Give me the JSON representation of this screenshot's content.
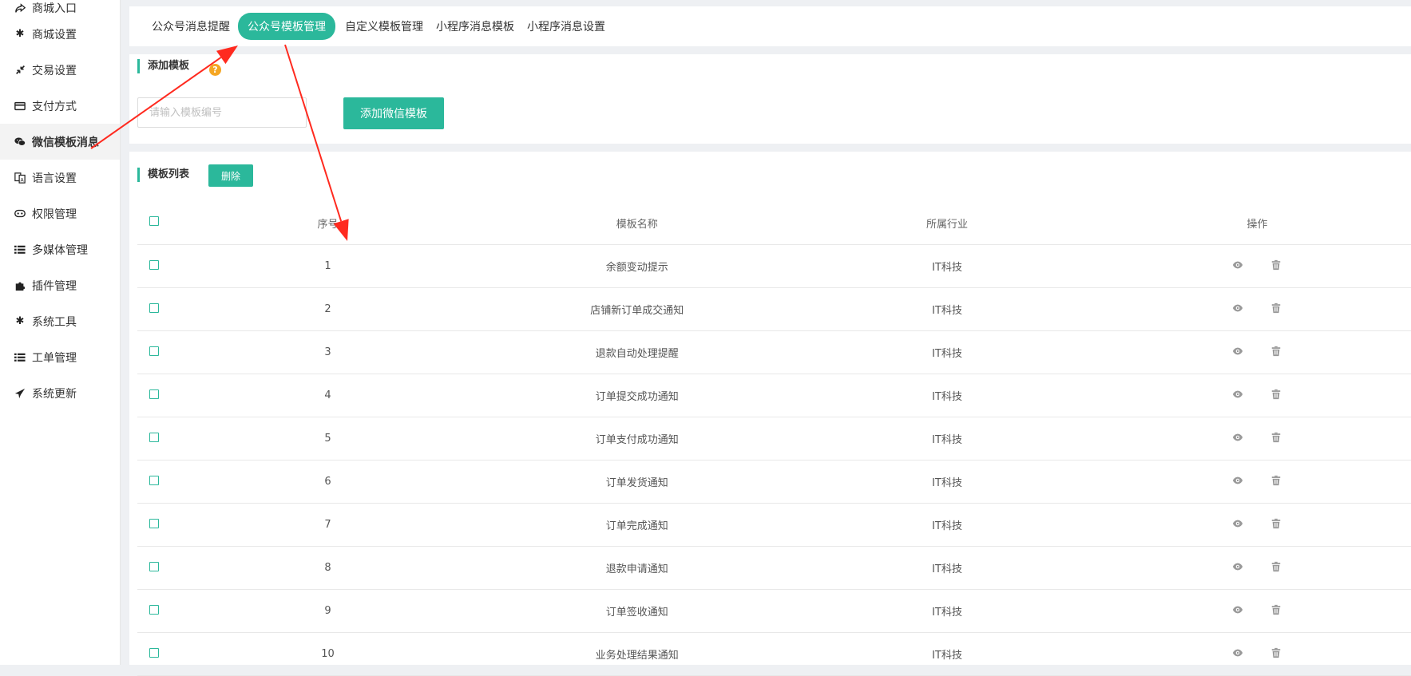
{
  "sidebar": {
    "items": [
      {
        "label": "商城入口",
        "icon": "share-icon"
      },
      {
        "label": "商城设置",
        "icon": "gear-icon"
      },
      {
        "label": "交易设置",
        "icon": "compress-icon"
      },
      {
        "label": "支付方式",
        "icon": "credit-card-icon"
      },
      {
        "label": "微信模板消息",
        "icon": "wechat-icon"
      },
      {
        "label": "语言设置",
        "icon": "translate-icon"
      },
      {
        "label": "权限管理",
        "icon": "gamepad-icon"
      },
      {
        "label": "多媒体管理",
        "icon": "list-icon"
      },
      {
        "label": "插件管理",
        "icon": "puzzle-icon"
      },
      {
        "label": "系统工具",
        "icon": "gear-icon"
      },
      {
        "label": "工单管理",
        "icon": "list-icon"
      },
      {
        "label": "系统更新",
        "icon": "paper-plane-icon"
      }
    ],
    "active_index": 4
  },
  "tabs": [
    {
      "label": "公众号消息提醒"
    },
    {
      "label": "公众号模板管理"
    },
    {
      "label": "自定义模板管理"
    },
    {
      "label": "小程序消息模板"
    },
    {
      "label": "小程序消息设置"
    }
  ],
  "add_section": {
    "title": "添加模板",
    "help": "?",
    "input_placeholder": "请输入模板编号",
    "input_value": "",
    "add_button": "添加微信模板"
  },
  "list_section": {
    "title": "模板列表",
    "delete_button": "删除",
    "columns": [
      "序号",
      "模板名称",
      "所属行业",
      "操作"
    ],
    "rows": [
      {
        "index": "1",
        "name": "余额变动提示",
        "industry": "IT科技"
      },
      {
        "index": "2",
        "name": "店铺新订单成交通知",
        "industry": "IT科技"
      },
      {
        "index": "3",
        "name": "退款自动处理提醒",
        "industry": "IT科技"
      },
      {
        "index": "4",
        "name": "订单提交成功通知",
        "industry": "IT科技"
      },
      {
        "index": "5",
        "name": "订单支付成功通知",
        "industry": "IT科技"
      },
      {
        "index": "6",
        "name": "订单发货通知",
        "industry": "IT科技"
      },
      {
        "index": "7",
        "name": "订单完成通知",
        "industry": "IT科技"
      },
      {
        "index": "8",
        "name": "退款申请通知",
        "industry": "IT科技"
      },
      {
        "index": "9",
        "name": "订单签收通知",
        "industry": "IT科技"
      },
      {
        "index": "10",
        "name": "业务处理结果通知",
        "industry": "IT科技"
      }
    ]
  },
  "colors": {
    "accent": "#2bb89b",
    "help_badge": "#f5a623",
    "arrow": "#ff2a1f"
  }
}
